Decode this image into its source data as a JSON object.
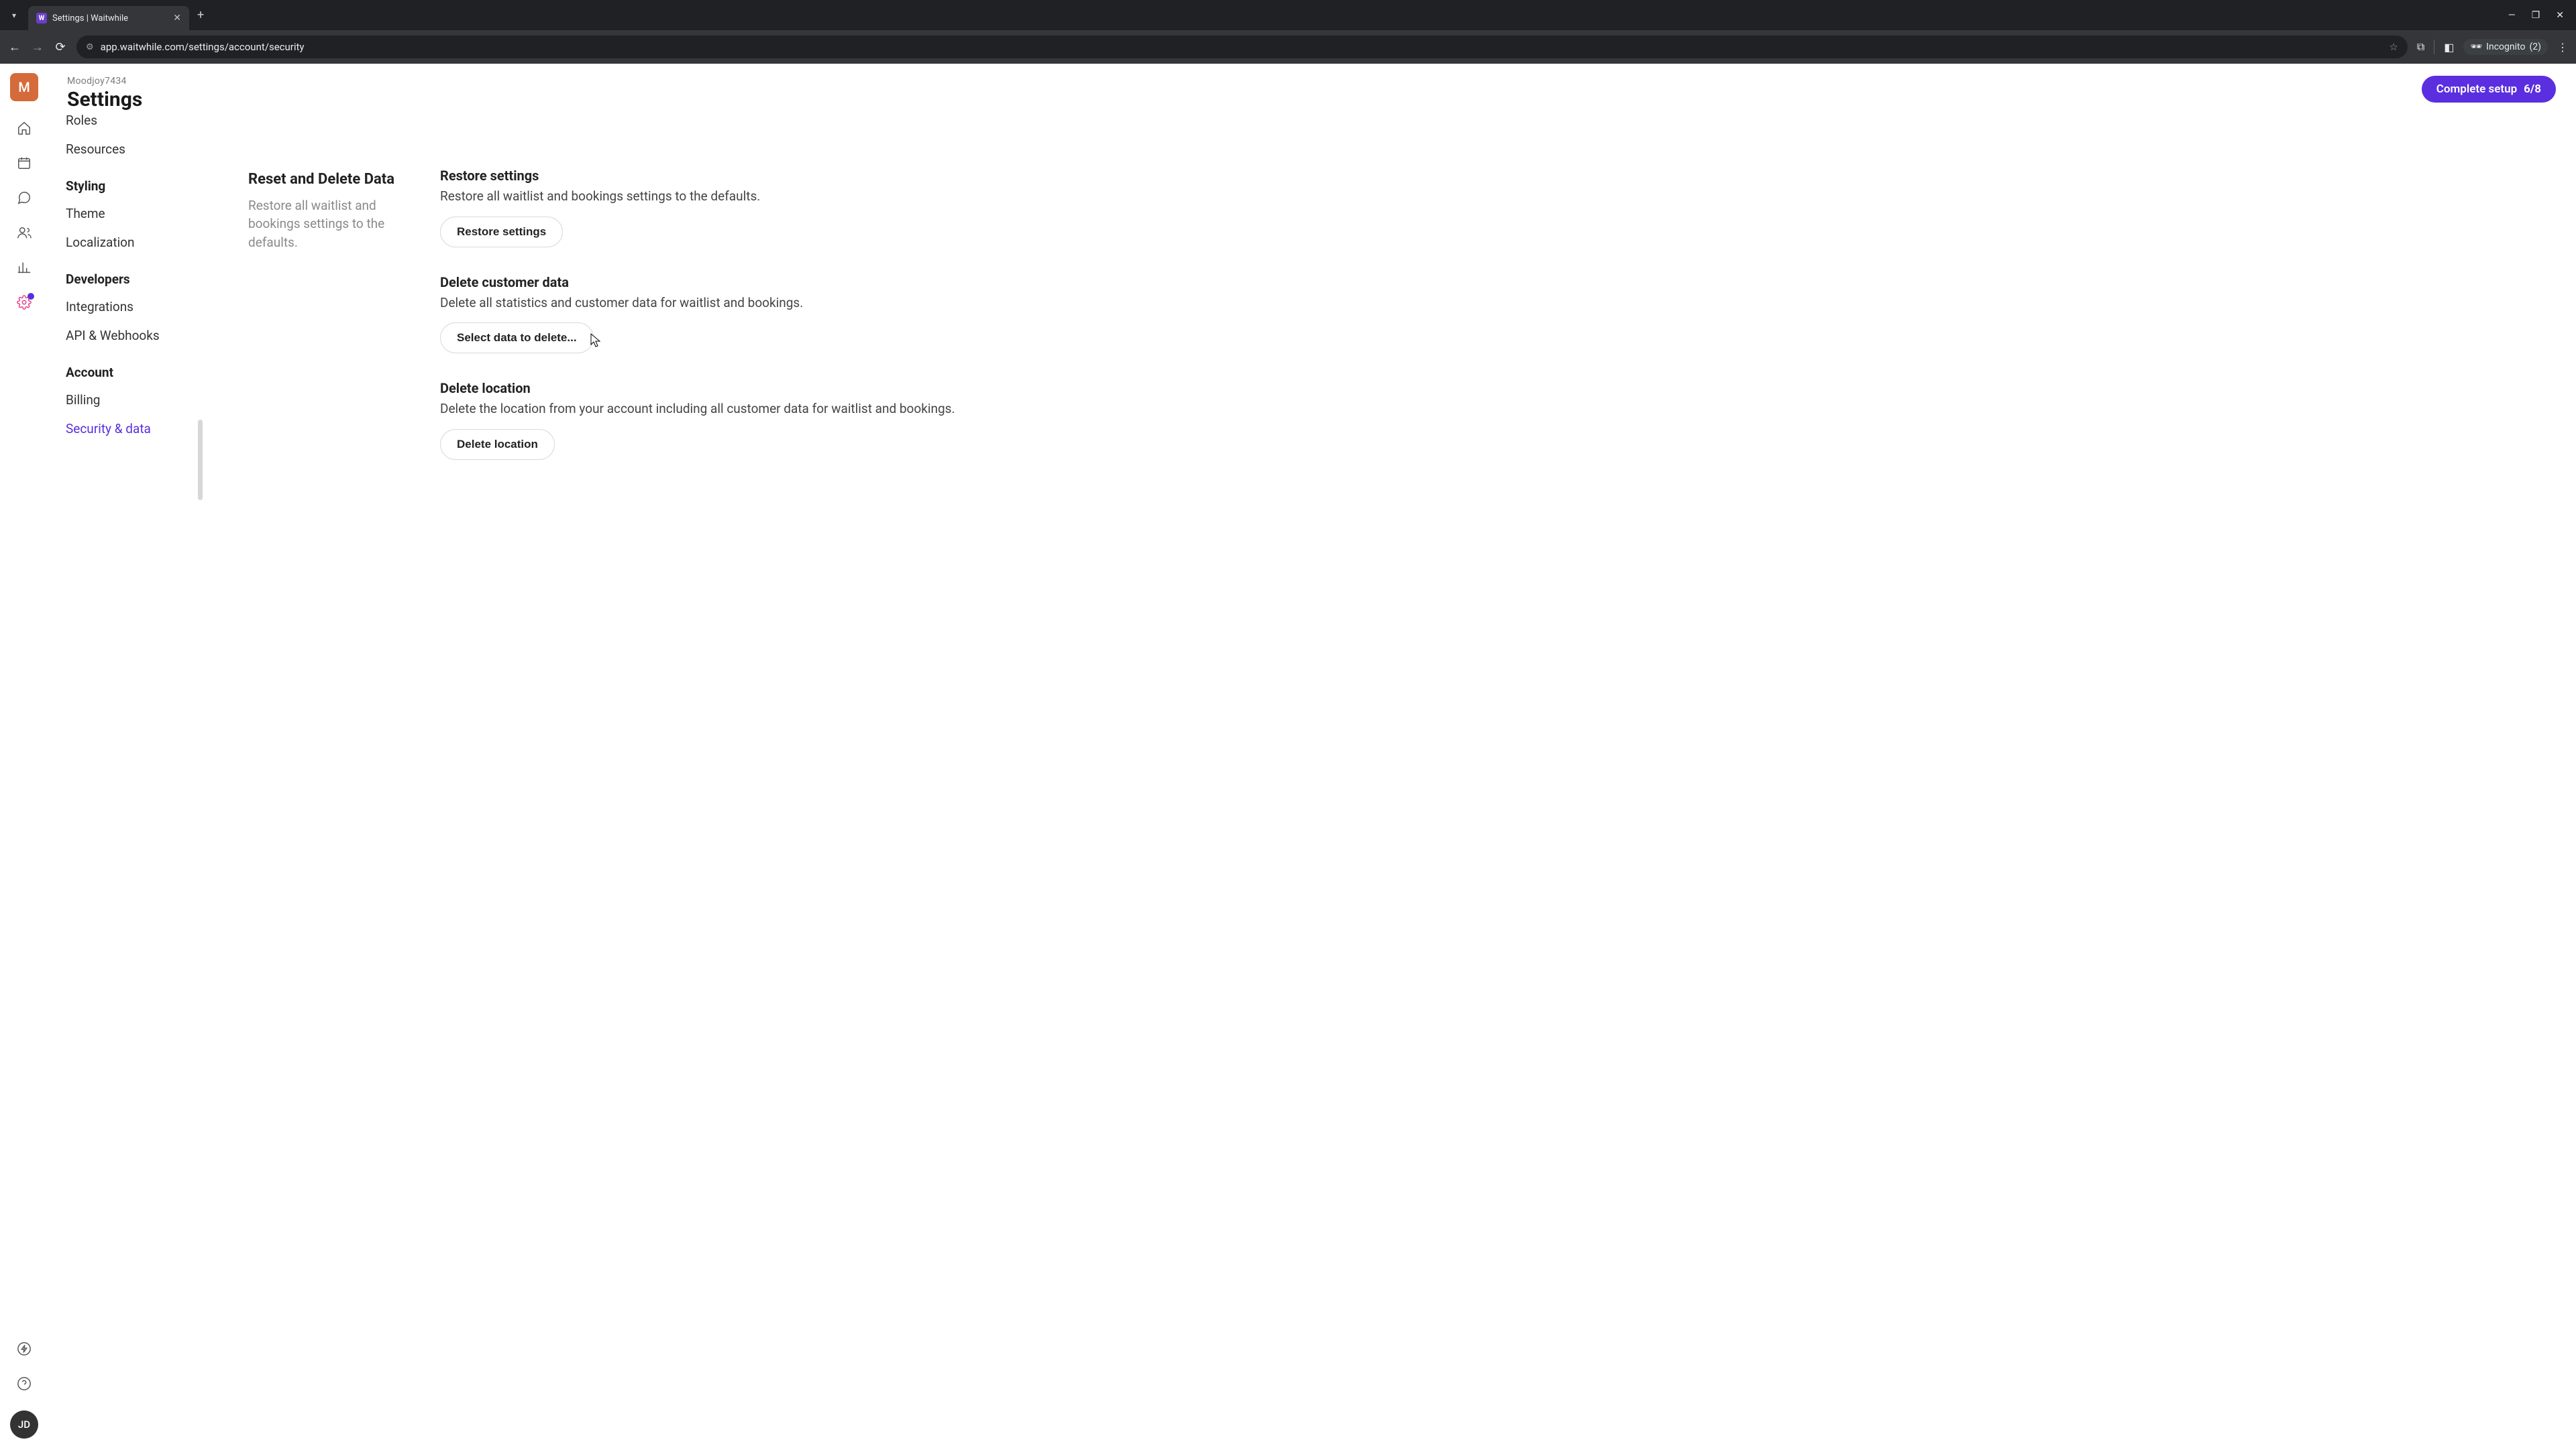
{
  "browser": {
    "tab_title": "Settings | Waitwhile",
    "url": "app.waitwhile.com/settings/account/security",
    "incognito_label": "Incognito",
    "incognito_count": "(2)"
  },
  "app": {
    "org_initial": "M",
    "org_name": "Moodjoy7434",
    "page_title": "Settings",
    "setup_label": "Complete setup",
    "setup_progress": "6/8",
    "user_initials": "JD"
  },
  "nav": {
    "roles": "Roles",
    "resources": "Resources",
    "styling_heading": "Styling",
    "theme": "Theme",
    "localization": "Localization",
    "developers_heading": "Developers",
    "integrations": "Integrations",
    "api_webhooks": "API & Webhooks",
    "account_heading": "Account",
    "billing": "Billing",
    "security_data": "Security & data"
  },
  "section": {
    "title": "Reset and Delete Data",
    "subtitle": "Restore all waitlist and bookings settings to the defaults.",
    "restore": {
      "heading": "Restore settings",
      "desc": "Restore all waitlist and bookings settings to the defaults.",
      "button": "Restore settings"
    },
    "delete_customer": {
      "heading": "Delete customer data",
      "desc": "Delete all statistics and customer data for waitlist and bookings.",
      "button": "Select data to delete..."
    },
    "delete_location": {
      "heading": "Delete location",
      "desc": "Delete the location from your account including all customer data for waitlist and bookings.",
      "button": "Delete location"
    }
  }
}
